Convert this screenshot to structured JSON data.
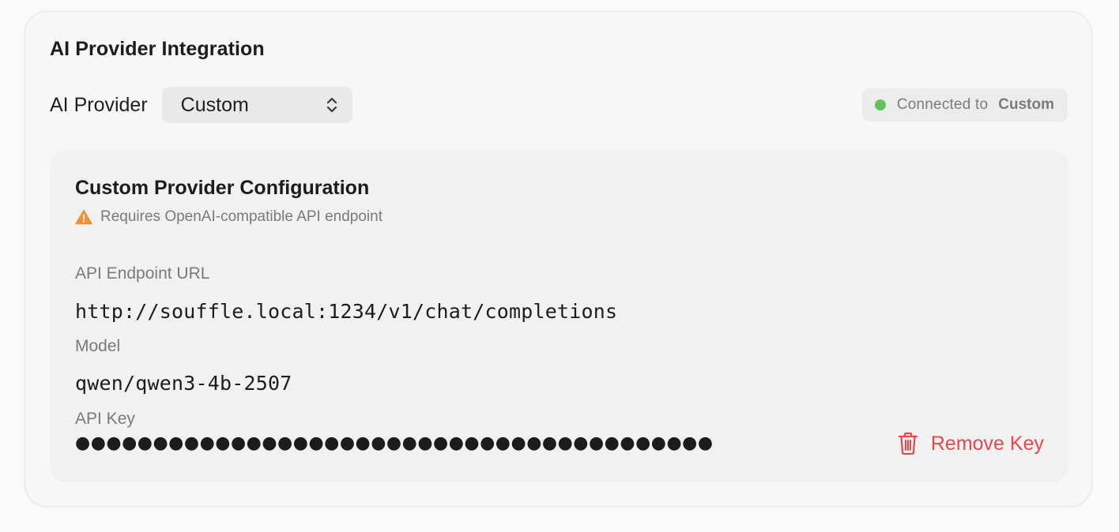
{
  "section": {
    "title": "AI Provider Integration"
  },
  "provider": {
    "label": "AI Provider",
    "selected": "Custom"
  },
  "status": {
    "prefix": "Connected to",
    "provider": "Custom",
    "dot_color": "#5fc35f"
  },
  "custom_config": {
    "title": "Custom Provider Configuration",
    "warning": "Requires OpenAI-compatible API endpoint",
    "warning_color": "#f0903a",
    "endpoint_label": "API Endpoint URL",
    "endpoint_value": "http://souffle.local:1234/v1/chat/completions",
    "model_label": "Model",
    "model_value": "qwen/qwen3-4b-2507",
    "api_key_label": "API Key",
    "api_key_masked": "●●●●●●●●●●●●●●●●●●●●●●●●●●●●●●●●●●●●●●●●●",
    "remove_key_label": "Remove Key",
    "remove_color": "#e5484d"
  },
  "icons": {
    "select": "chevron-up-down-icon",
    "warning": "warning-triangle-icon",
    "remove": "trash-icon"
  }
}
